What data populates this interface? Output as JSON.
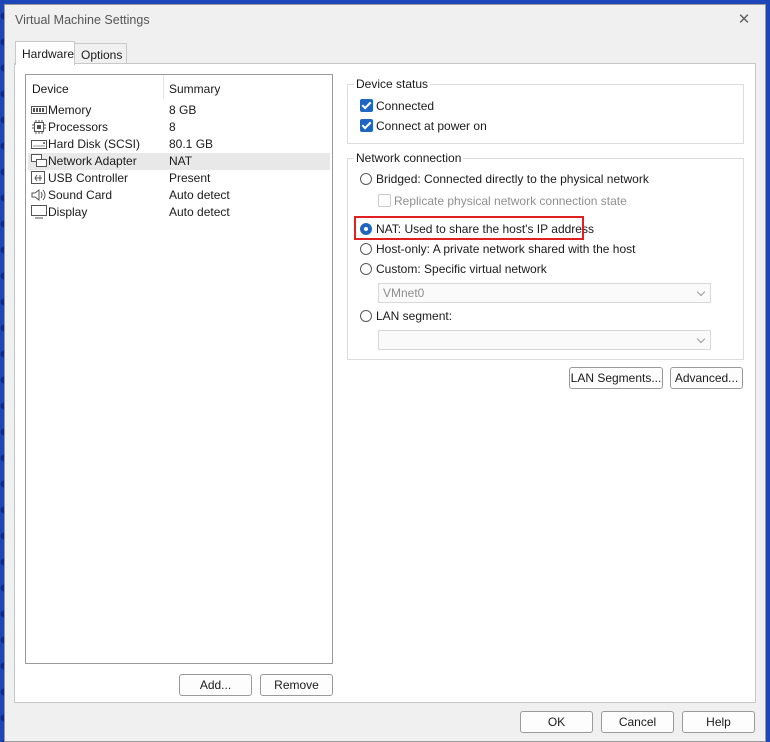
{
  "window": {
    "title": "Virtual Machine Settings",
    "close": "✕"
  },
  "tabs": [
    {
      "label": "Hardware"
    },
    {
      "label": "Options"
    }
  ],
  "device_list": {
    "headers": {
      "device": "Device",
      "summary": "Summary"
    },
    "rows": [
      {
        "name": "Memory",
        "summary": "8 GB",
        "icon": "memory-icon"
      },
      {
        "name": "Processors",
        "summary": "8",
        "icon": "processor-icon"
      },
      {
        "name": "Hard Disk (SCSI)",
        "summary": "80.1 GB",
        "icon": "hard-disk-icon"
      },
      {
        "name": "Network Adapter",
        "summary": "NAT",
        "icon": "network-adapter-icon",
        "selected": true
      },
      {
        "name": "USB Controller",
        "summary": "Present",
        "icon": "usb-icon"
      },
      {
        "name": "Sound Card",
        "summary": "Auto detect",
        "icon": "speaker-icon"
      },
      {
        "name": "Display",
        "summary": "Auto detect",
        "icon": "display-icon"
      }
    ],
    "add_label": "Add...",
    "remove_label": "Remove"
  },
  "device_status": {
    "title": "Device status",
    "connected": "Connected",
    "connect_at_power_on": "Connect at power on"
  },
  "network_connection": {
    "title": "Network connection",
    "bridged": "Bridged: Connected directly to the physical network",
    "replicate": "Replicate physical network connection state",
    "nat": "NAT: Used to share the host's IP address",
    "host_only": "Host-only: A private network shared with the host",
    "custom": "Custom: Specific virtual network",
    "custom_value": "VMnet0",
    "lan_segment": "LAN segment:",
    "lan_segment_value": "",
    "selected": "nat"
  },
  "buttons": {
    "lan_segments": "LAN Segments...",
    "advanced": "Advanced...",
    "ok": "OK",
    "cancel": "Cancel",
    "help": "Help"
  },
  "colors": {
    "accent": "#1f66c2",
    "highlight": "#e02020"
  }
}
